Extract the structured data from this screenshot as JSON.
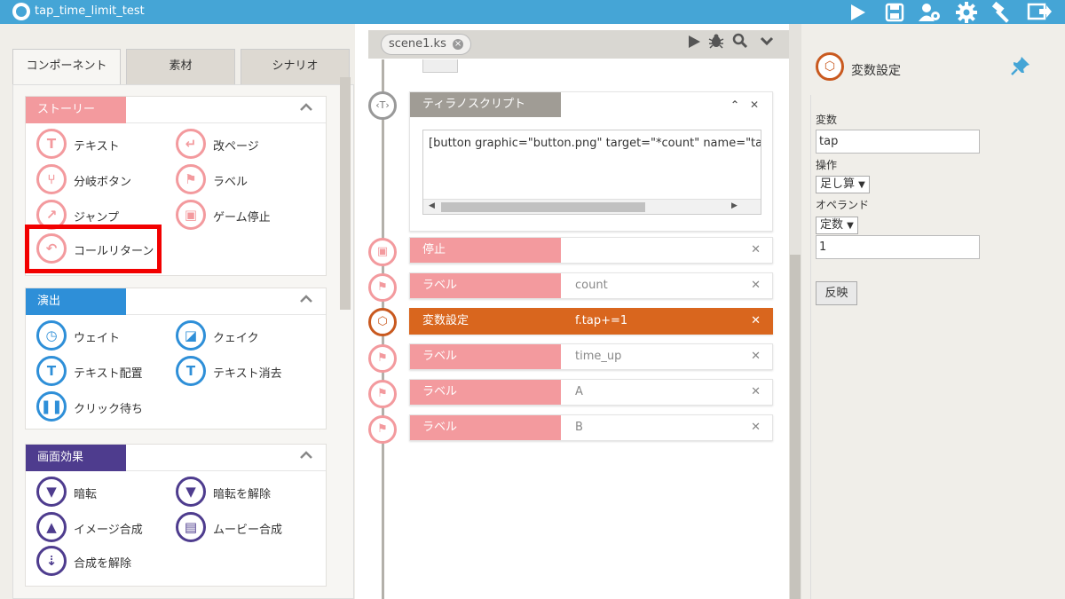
{
  "app": {
    "title": "tap_time_limit_test"
  },
  "toolbar": {
    "icons": [
      "play-icon",
      "save-icon",
      "users-gear-icon",
      "gear-icon",
      "hammer-icon",
      "export-icon"
    ]
  },
  "left_panel": {
    "tabs": [
      "コンポーネント",
      "素材",
      "シナリオ"
    ],
    "groups": [
      {
        "title": "ストーリー",
        "color": "#f39a9e",
        "items": [
          "テキスト",
          "改ページ",
          "分岐ボタン",
          "ラベル",
          "ジャンプ",
          "ゲーム停止",
          "コールリターン"
        ]
      },
      {
        "title": "演出",
        "color": "#2e8fd8",
        "items": [
          "ウェイト",
          "クェイク",
          "テキスト配置",
          "テキスト消去",
          "クリック待ち"
        ]
      },
      {
        "title": "画面効果",
        "color": "#4e3c8e",
        "items": [
          "暗転",
          "暗転を解除",
          "イメージ合成",
          "ムービー合成",
          "合成を解除"
        ]
      }
    ],
    "highlighted_item": "コールリターン"
  },
  "editor": {
    "file_tab": "scene1.ks",
    "script_block": {
      "title": "ティラノスクリプト",
      "code": "[button graphic=\"button.png\" target=\"*count\" name=\"tap\" x="
    },
    "rows": [
      {
        "title": "停止",
        "value": "",
        "color": "#f39a9e",
        "kind": "stop"
      },
      {
        "title": "ラベル",
        "value": "count",
        "color": "#f39a9e",
        "kind": "label"
      },
      {
        "title": "変数設定",
        "value": "f.tap+=1",
        "color": "#d9661e",
        "kind": "var"
      },
      {
        "title": "ラベル",
        "value": "time_up",
        "color": "#f39a9e",
        "kind": "label"
      },
      {
        "title": "ラベル",
        "value": "A",
        "color": "#f39a9e",
        "kind": "label"
      },
      {
        "title": "ラベル",
        "value": "B",
        "color": "#f39a9e",
        "kind": "label"
      }
    ]
  },
  "properties": {
    "title": "変数設定",
    "variable_label": "変数",
    "variable_value": "tap",
    "operation_label": "操作",
    "operation_value": "足し算",
    "operand_label": "オペランド",
    "operand_type": "定数",
    "operand_value": "1",
    "apply_label": "反映"
  }
}
